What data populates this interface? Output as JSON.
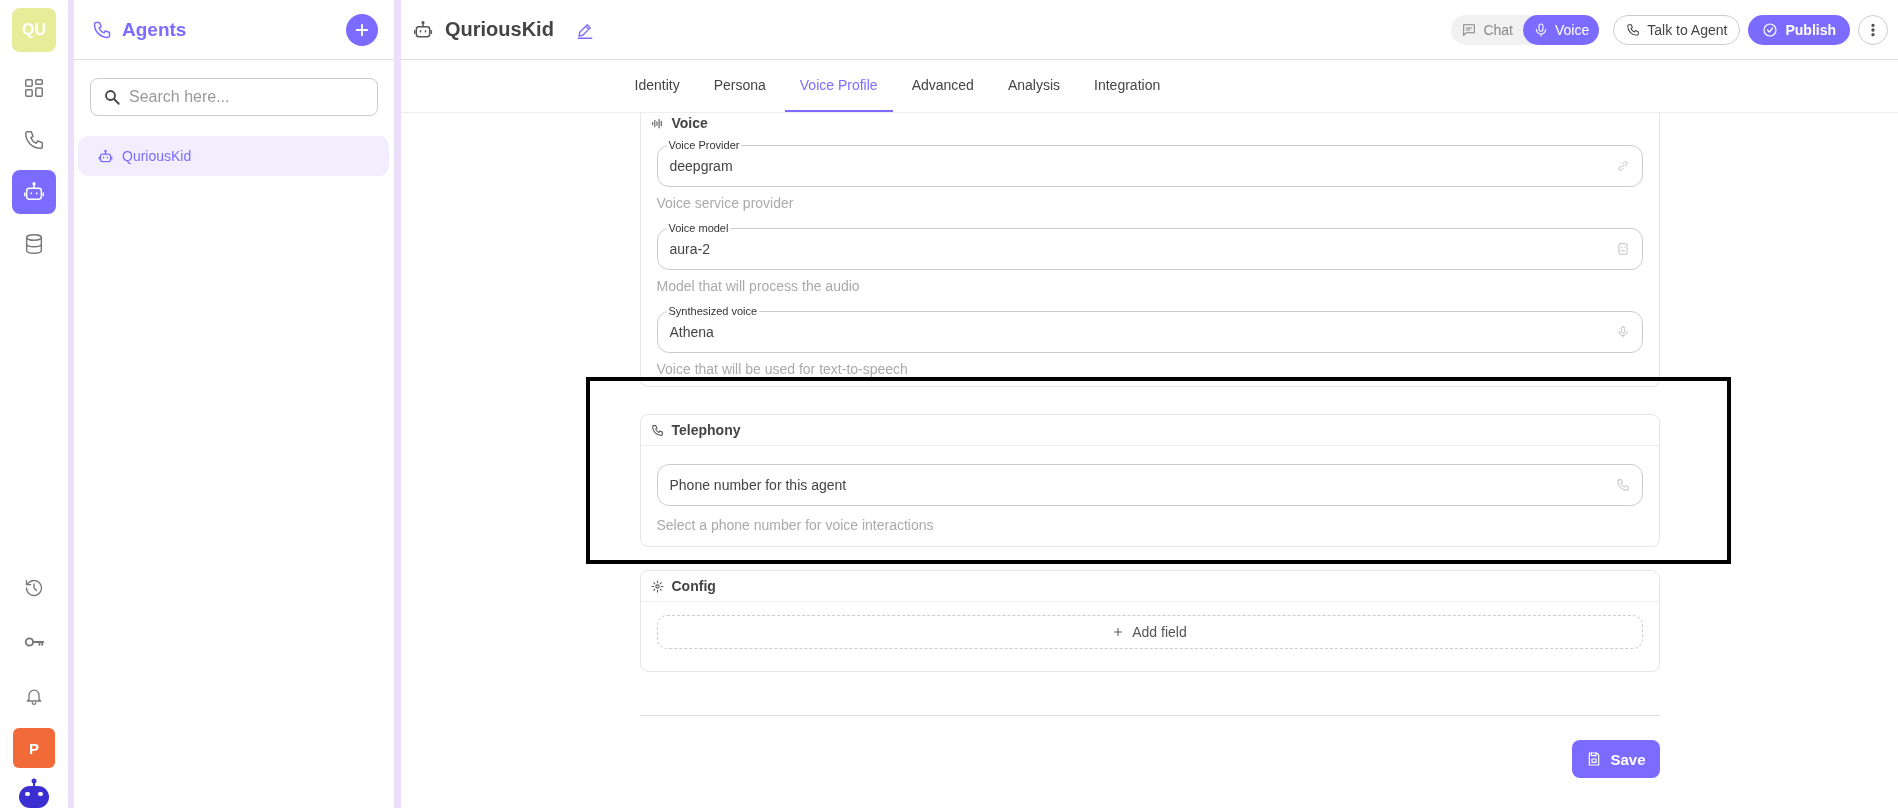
{
  "rail": {
    "logo": "QU",
    "items": [
      {
        "selected": false
      },
      {
        "selected": false
      },
      {
        "selected": true
      },
      {
        "selected": false
      }
    ],
    "avatar": "P"
  },
  "agents_panel": {
    "title": "Agents",
    "search": {
      "placeholder": "Search here..."
    },
    "agents": [
      {
        "name": "QuriousKid",
        "selected": true
      }
    ]
  },
  "header": {
    "title": "QuriousKid",
    "mode_toggle": [
      {
        "label": "Chat",
        "selected": false
      },
      {
        "label": "Voice",
        "selected": true
      }
    ],
    "talk_button": "Talk to Agent",
    "publish_button": "Publish"
  },
  "tabs": [
    {
      "label": "Identity",
      "selected": false
    },
    {
      "label": "Persona",
      "selected": false
    },
    {
      "label": "Voice Profile",
      "selected": true
    },
    {
      "label": "Advanced",
      "selected": false
    },
    {
      "label": "Analysis",
      "selected": false
    },
    {
      "label": "Integration",
      "selected": false
    }
  ],
  "sections": [
    {
      "kind": "fields",
      "title": "Voice",
      "highlighted": false,
      "fields": [
        {
          "label": "Voice Provider",
          "value": "deepgram",
          "helper": "Voice service provider"
        },
        {
          "label": "Voice model",
          "value": "aura-2",
          "helper": "Model that will process the audio"
        },
        {
          "label": "Synthesized voice",
          "value": "Athena",
          "helper": "Voice that will be used for text-to-speech"
        }
      ]
    },
    {
      "kind": "fields",
      "title": "Telephony",
      "highlighted": true,
      "fields": [
        {
          "value": "Phone number for this agent",
          "helper": "Select a phone number for voice interactions"
        }
      ]
    },
    {
      "kind": "config",
      "title": "Config",
      "highlighted": false,
      "add_button": "Add field"
    }
  ],
  "save_button": "Save"
}
